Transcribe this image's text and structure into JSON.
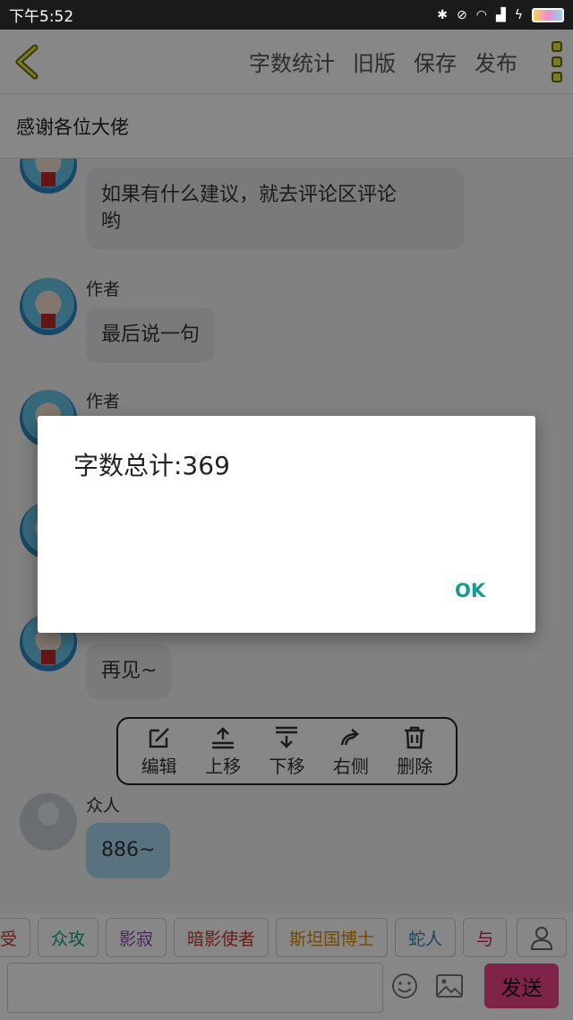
{
  "status_bar": {
    "time": "下午5:52"
  },
  "toolbar": {
    "word_count": "字数统计",
    "old_version": "旧版",
    "save": "保存",
    "publish": "发布"
  },
  "title": "感谢各位大佬",
  "messages": [
    {
      "sender": "",
      "text_line1": "如果有什么建议，就去评论区评论",
      "text_line2": "哟"
    },
    {
      "sender": "作者",
      "text": "最后说一句"
    },
    {
      "sender": "作者",
      "text": ""
    },
    {
      "sender": "",
      "text": "再见~"
    },
    {
      "sender": "众人",
      "text": "886~"
    }
  ],
  "message_actions": [
    {
      "icon": "edit-icon",
      "label": "编辑"
    },
    {
      "icon": "move-up-icon",
      "label": "上移"
    },
    {
      "icon": "move-down-icon",
      "label": "下移"
    },
    {
      "icon": "right-side-icon",
      "label": "右侧"
    },
    {
      "icon": "delete-icon",
      "label": "删除"
    }
  ],
  "tags": [
    {
      "label": "受",
      "color": "#c0392b"
    },
    {
      "label": "众攻",
      "color": "#16a085"
    },
    {
      "label": "影寂",
      "color": "#8e44ad"
    },
    {
      "label": "暗影使者",
      "color": "#c0392b"
    },
    {
      "label": "斯坦国博士",
      "color": "#d68910"
    },
    {
      "label": "蛇人",
      "color": "#2e86c1"
    },
    {
      "label": "与",
      "color": "#c2185b"
    }
  ],
  "input": {
    "send": "发送"
  },
  "dialog": {
    "title": "字数总计:369",
    "ok": "OK"
  }
}
